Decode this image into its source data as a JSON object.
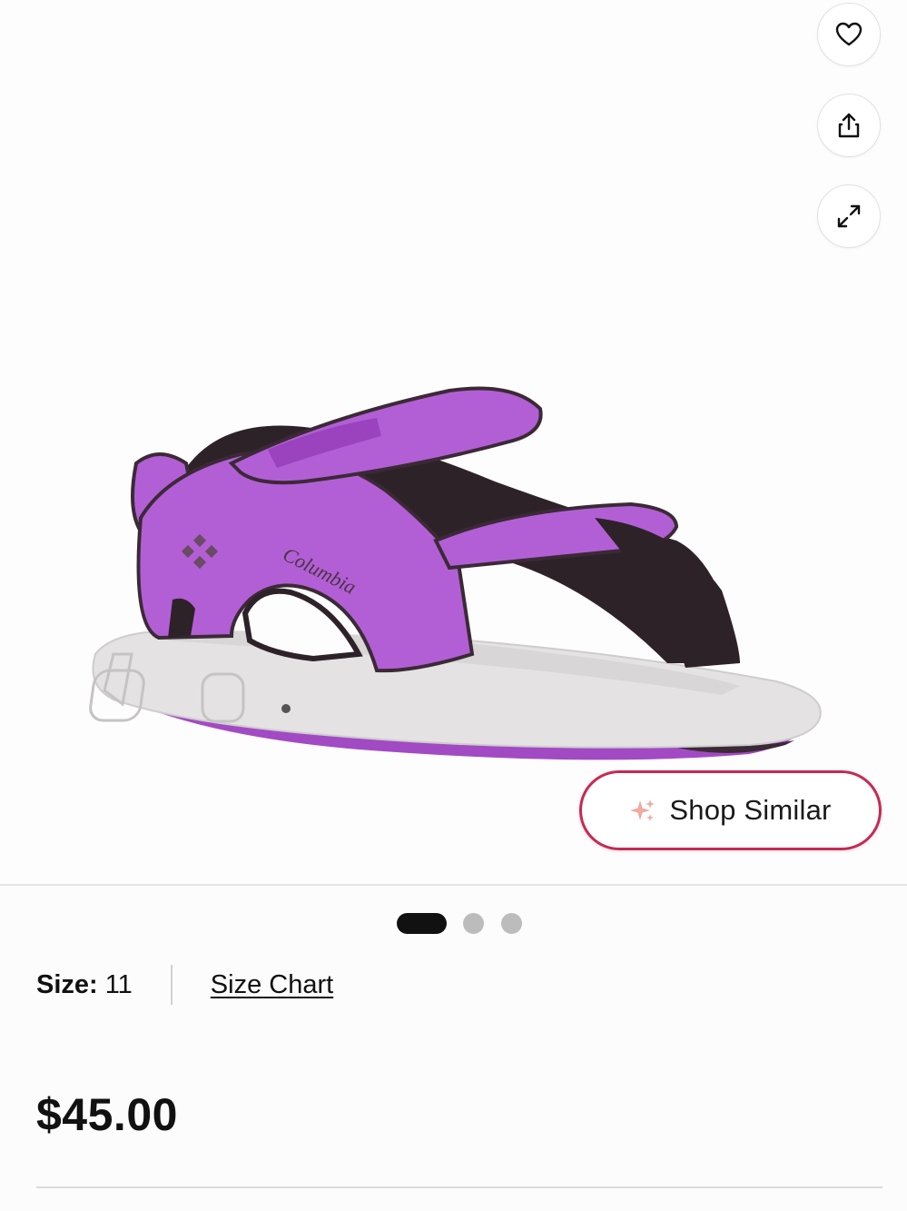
{
  "product": {
    "image_alt": "Purple Columbia kids sandal",
    "brand_mark": "Columbia",
    "colors": {
      "upper": "#b25fd6",
      "strap_dark": "#3b2a36",
      "sole": "#e4e2e3",
      "outsole": "#a24ac3"
    }
  },
  "actions": {
    "favorite_icon": "heart-icon",
    "share_icon": "share-icon",
    "expand_icon": "expand-icon"
  },
  "shop_similar": {
    "label": "Shop Similar",
    "icon": "sparkle-icon",
    "accent": "#c62a53"
  },
  "carousel": {
    "total": 3,
    "active": 1
  },
  "size": {
    "label": "Size:",
    "value": "11",
    "chart_link": "Size Chart"
  },
  "price": "$45.00"
}
